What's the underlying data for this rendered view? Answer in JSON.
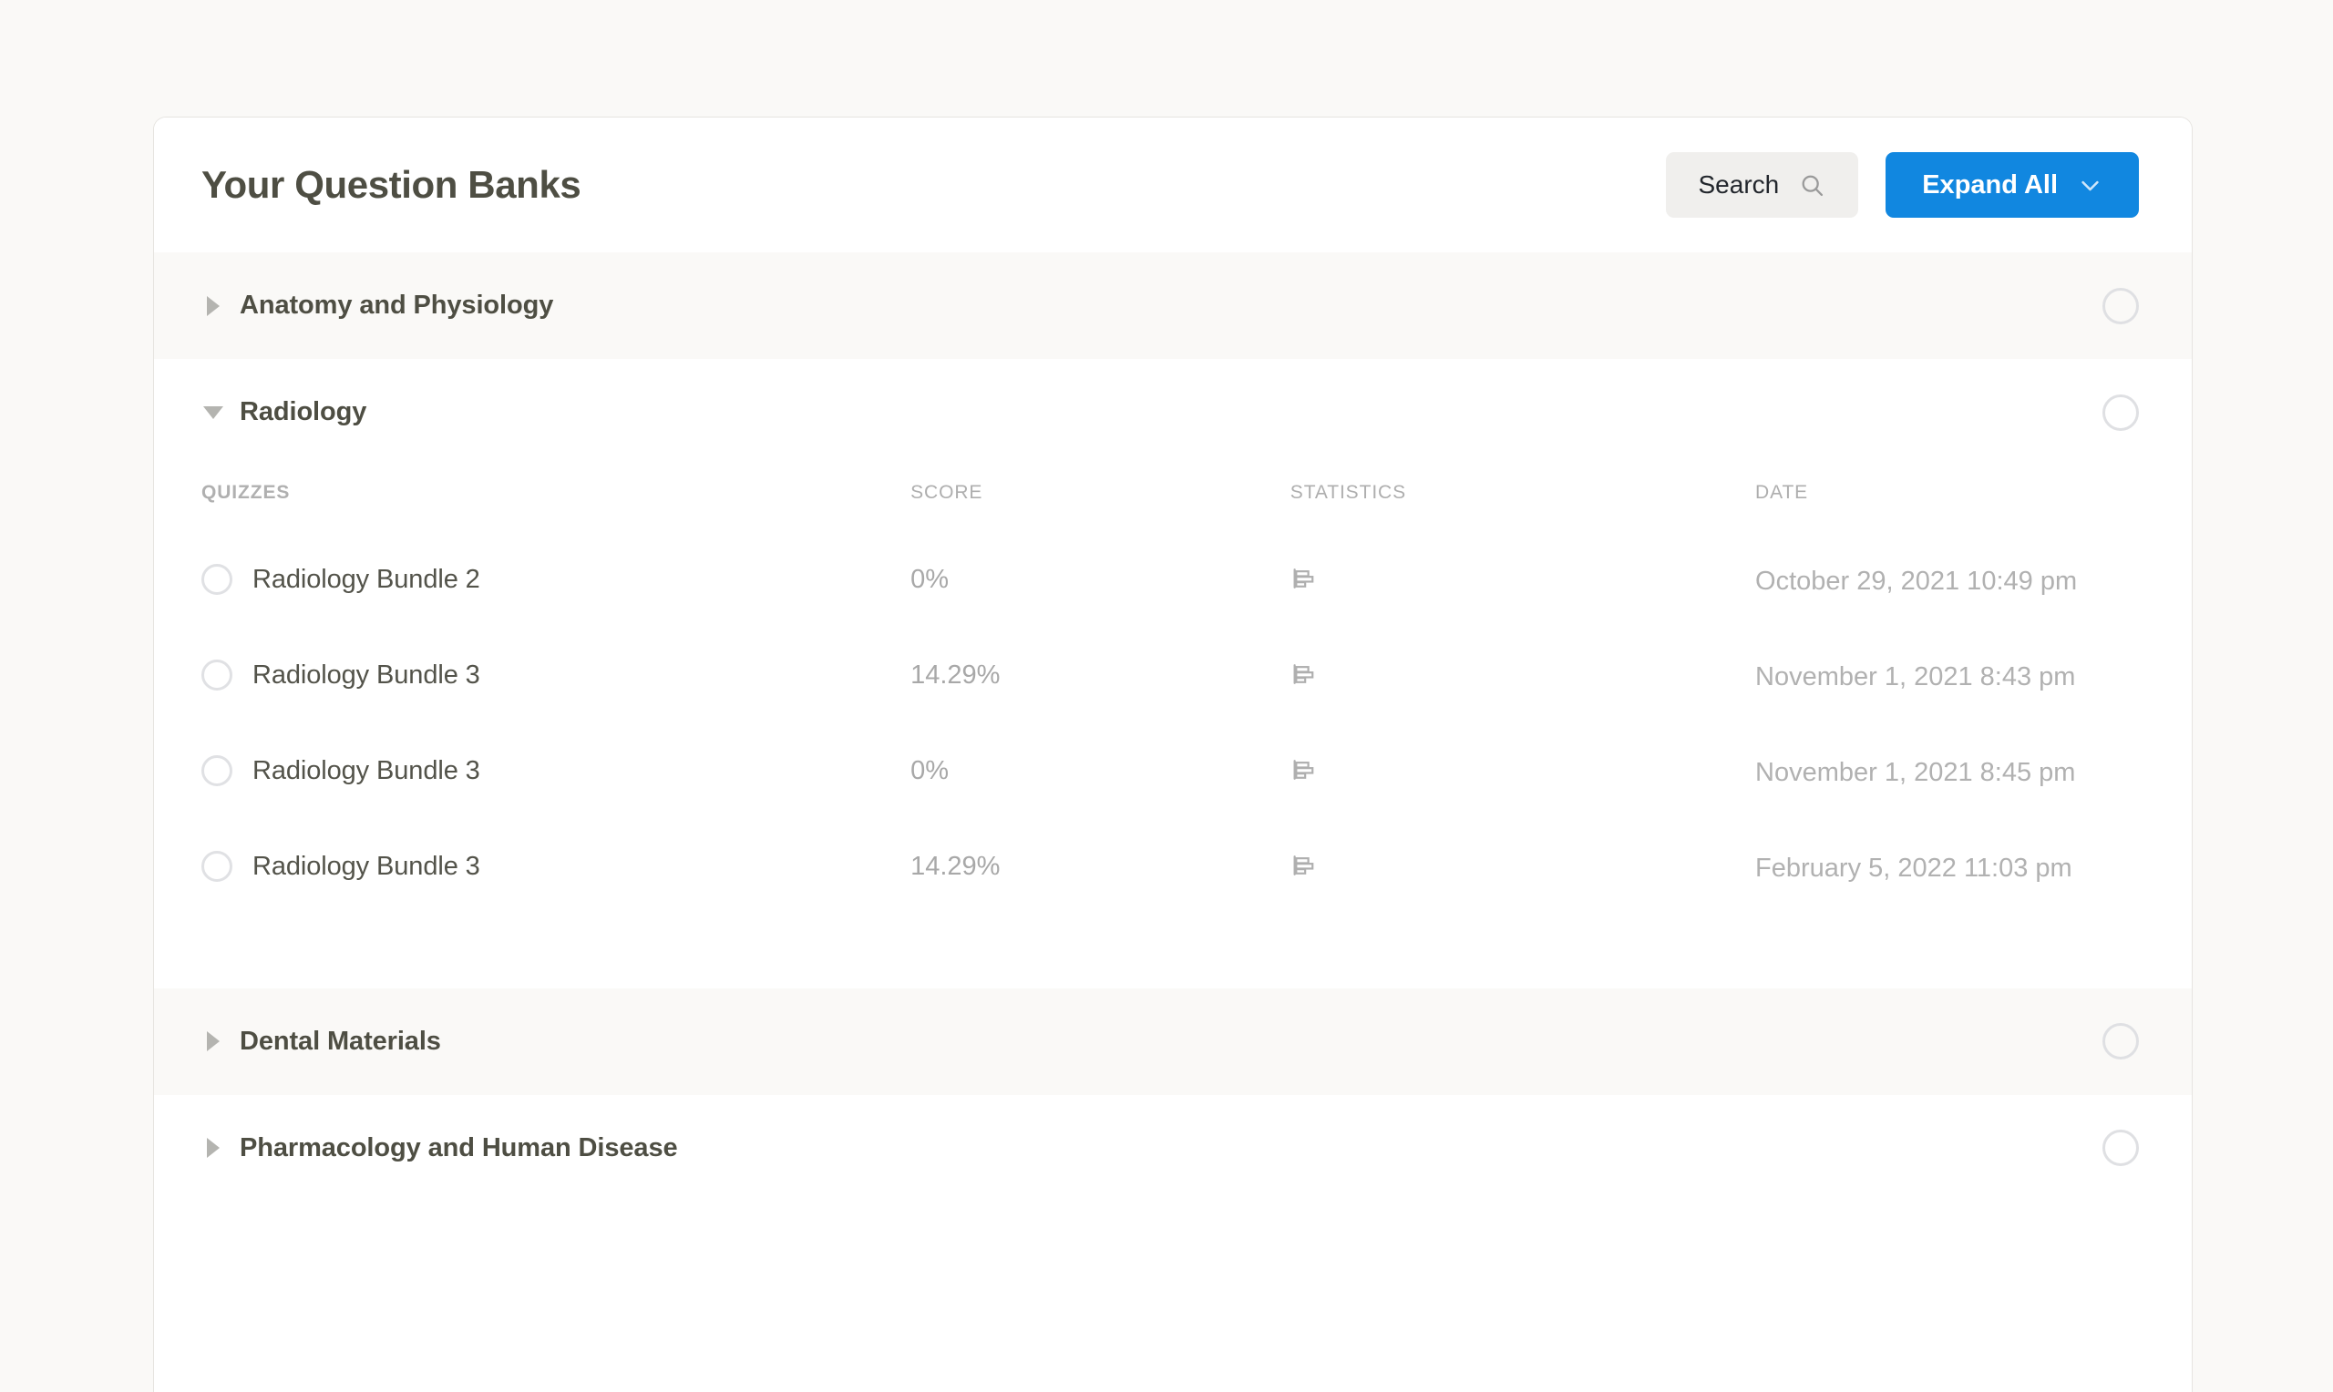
{
  "page": {
    "background": "#faf9f7",
    "accent": "#1187e0"
  },
  "header": {
    "title": "Your Question Banks",
    "search_label": "Search",
    "search_icon": "search-icon",
    "expand_all_label": "Expand All",
    "expand_all_icon": "chevron-down-icon"
  },
  "table_headers": {
    "quizzes": "QUIZZES",
    "score": "SCORE",
    "statistics": "STATISTICS",
    "date": "DATE"
  },
  "sections": [
    {
      "label": "Anatomy and Physiology",
      "expanded": false,
      "caret_icon": "caret-right-icon",
      "select_icon": "circle-outline-icon"
    },
    {
      "label": "Radiology",
      "expanded": true,
      "caret_icon": "caret-down-icon",
      "select_icon": "circle-outline-icon",
      "quizzes": [
        {
          "name": "Radiology Bundle 2",
          "score": "0%",
          "statistics_icon": "bar-chart-icon",
          "date": "October 29, 2021 10:49 pm"
        },
        {
          "name": "Radiology Bundle 3",
          "score": "14.29%",
          "statistics_icon": "bar-chart-icon",
          "date": "November 1, 2021 8:43 pm"
        },
        {
          "name": "Radiology Bundle 3",
          "score": "0%",
          "statistics_icon": "bar-chart-icon",
          "date": "November 1, 2021 8:45 pm"
        },
        {
          "name": "Radiology Bundle 3",
          "score": "14.29%",
          "statistics_icon": "bar-chart-icon",
          "date": "February 5, 2022 11:03 pm"
        }
      ]
    },
    {
      "label": "Dental Materials",
      "expanded": false,
      "caret_icon": "caret-right-icon",
      "select_icon": "circle-outline-icon"
    },
    {
      "label": "Pharmacology and Human Disease",
      "expanded": false,
      "caret_icon": "caret-right-icon",
      "select_icon": "circle-outline-icon"
    }
  ]
}
